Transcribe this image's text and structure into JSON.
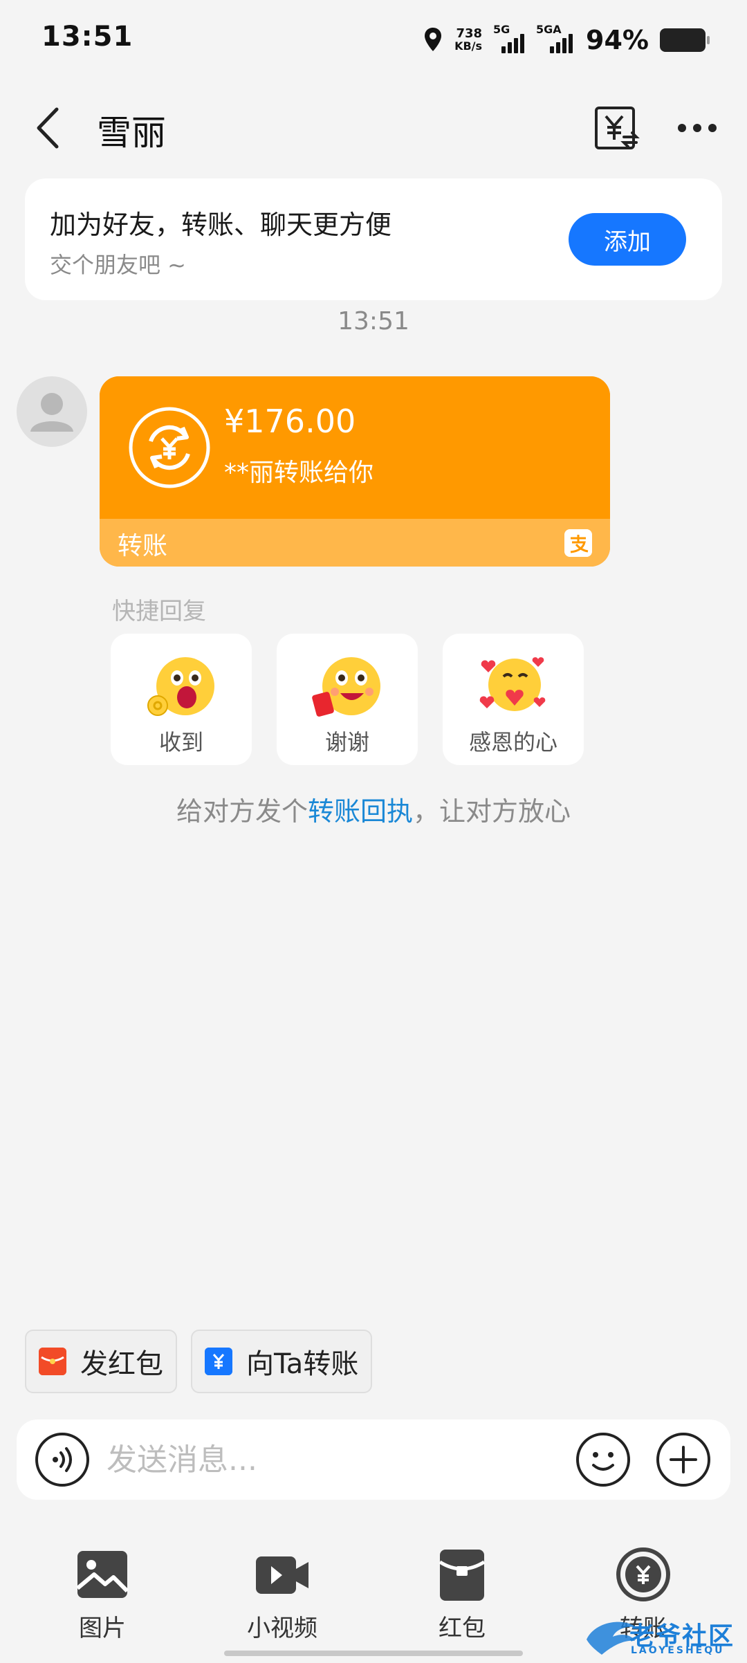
{
  "status_bar": {
    "time": "13:51",
    "net_speed_value": "738",
    "net_speed_unit": "KB/s",
    "signal1_label": "5G",
    "signal2_label": "5GA",
    "battery_percent": "94%"
  },
  "header": {
    "title": "雪丽",
    "icons": {
      "back": "chevron-left-icon",
      "transfer_record": "yuan-exchange-icon",
      "more": "more-dots-icon"
    }
  },
  "friend_banner": {
    "title": "加为好友，转账、聊天更方便",
    "subtitle": "交个朋友吧 ~",
    "add_label": "添加"
  },
  "chat": {
    "time": "13:51",
    "transfer": {
      "amount": "¥176.00",
      "note": "**丽转账给你",
      "label": "转账",
      "color": "#ff9900"
    }
  },
  "quick_reply": {
    "title": "快捷回复",
    "items": [
      {
        "label": "收到",
        "emoji": "ok-face-emoji"
      },
      {
        "label": "谢谢",
        "emoji": "red-envelope-face-emoji"
      },
      {
        "label": "感恩的心",
        "emoji": "hearts-hug-emoji"
      }
    ]
  },
  "receipt_hint": {
    "prefix": "给对方发个",
    "link": "转账回执",
    "suffix": "，让对方放心"
  },
  "actions": {
    "red_packet": "发红包",
    "transfer_to": "向Ta转账"
  },
  "input": {
    "placeholder": "发送消息..."
  },
  "toolbar": {
    "items": [
      {
        "label": "图片",
        "icon": "image-icon"
      },
      {
        "label": "小视频",
        "icon": "video-icon"
      },
      {
        "label": "红包",
        "icon": "red-packet-icon"
      },
      {
        "label": "转账",
        "icon": "transfer-icon"
      }
    ]
  },
  "watermark": {
    "text": "老爷社区",
    "sub": "LAOYESHEQU"
  },
  "colors": {
    "accent_blue": "#1677ff",
    "transfer_orange": "#ff9900",
    "link_blue": "#1a88d6"
  }
}
